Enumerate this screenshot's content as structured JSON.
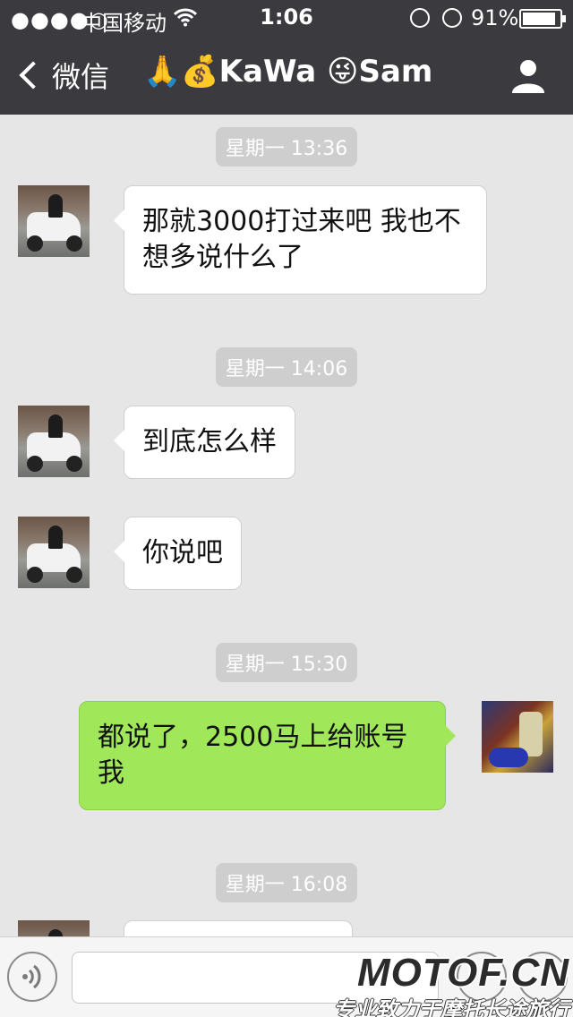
{
  "status_bar": {
    "signal": "●●●●○",
    "carrier": "中国移动",
    "time": "1:06",
    "battery_percent": "91%",
    "battery_level": 0.91
  },
  "nav": {
    "back_label": "微信",
    "title": "🙏💰KaWa 😜Sam"
  },
  "messages": [
    {
      "type": "timestamp",
      "text": "星期一 13:36"
    },
    {
      "type": "incoming",
      "text": "那就3000打过来吧 我也不想多说什么了"
    },
    {
      "type": "timestamp",
      "text": "星期一 14:06"
    },
    {
      "type": "incoming",
      "text": "到底怎么样"
    },
    {
      "type": "incoming",
      "text": "你说吧"
    },
    {
      "type": "timestamp",
      "text": "星期一 15:30"
    },
    {
      "type": "outgoing",
      "text": "都说了，2500马上给账号我"
    },
    {
      "type": "timestamp",
      "text": "星期一 16:08"
    }
  ],
  "input_bar": {
    "value": ""
  },
  "watermark": {
    "main": "MOTOF.CN",
    "sub": "专业致力于摩托长途旅行"
  },
  "colors": {
    "nav_bg": "#3a3a3f",
    "chat_bg": "#e6e6e6",
    "outgoing_bubble": "#a0e75a",
    "incoming_bubble": "#ffffff",
    "timestamp_bg": "#cecece"
  }
}
